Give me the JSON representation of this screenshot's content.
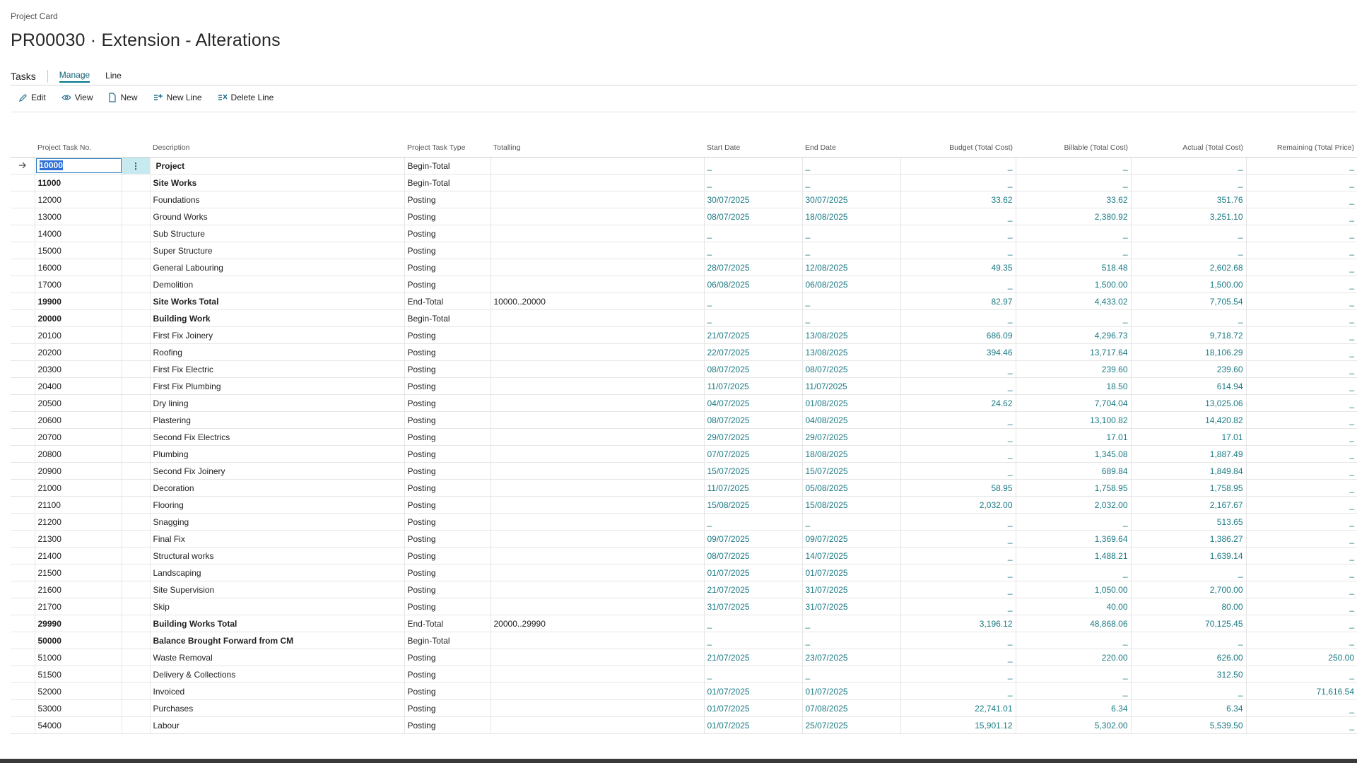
{
  "breadcrumb": "Project Card",
  "title": "PR00030 · Extension - Alterations",
  "menu": {
    "section": "Tasks",
    "tabs": [
      "Manage",
      "Line"
    ]
  },
  "actions": {
    "edit": "Edit",
    "view": "View",
    "new": "New",
    "new_line": "New Line",
    "delete_line": "Delete Line"
  },
  "columns": [
    "Project Task No.",
    "Description",
    "Project Task Type",
    "Totalling",
    "Start Date",
    "End Date",
    "Budget (Total Cost)",
    "Billable (Total Cost)",
    "Actual (Total Cost)",
    "Remaining (Total Price)"
  ],
  "rows": [
    {
      "no": "10000",
      "desc": "Project",
      "type": "Begin-Total",
      "tot": "",
      "start": "_",
      "end": "_",
      "budget": "_",
      "billable": "_",
      "actual": "_",
      "remaining": "_",
      "bold": true,
      "selected": true
    },
    {
      "no": "11000",
      "desc": "Site Works",
      "type": "Begin-Total",
      "tot": "",
      "start": "_",
      "end": "_",
      "budget": "_",
      "billable": "_",
      "actual": "_",
      "remaining": "_",
      "bold": true
    },
    {
      "no": "12000",
      "desc": "Foundations",
      "type": "Posting",
      "tot": "",
      "start": "30/07/2025",
      "end": "30/07/2025",
      "budget": "33.62",
      "billable": "33.62",
      "actual": "351.76",
      "remaining": "_"
    },
    {
      "no": "13000",
      "desc": "Ground Works",
      "type": "Posting",
      "tot": "",
      "start": "08/07/2025",
      "end": "18/08/2025",
      "budget": "_",
      "billable": "2,380.92",
      "actual": "3,251.10",
      "remaining": "_"
    },
    {
      "no": "14000",
      "desc": "Sub Structure",
      "type": "Posting",
      "tot": "",
      "start": "_",
      "end": "_",
      "budget": "_",
      "billable": "_",
      "actual": "_",
      "remaining": "_"
    },
    {
      "no": "15000",
      "desc": "Super Structure",
      "type": "Posting",
      "tot": "",
      "start": "_",
      "end": "_",
      "budget": "_",
      "billable": "_",
      "actual": "_",
      "remaining": "_"
    },
    {
      "no": "16000",
      "desc": "General Labouring",
      "type": "Posting",
      "tot": "",
      "start": "28/07/2025",
      "end": "12/08/2025",
      "budget": "49.35",
      "billable": "518.48",
      "actual": "2,602.68",
      "remaining": "_"
    },
    {
      "no": "17000",
      "desc": "Demolition",
      "type": "Posting",
      "tot": "",
      "start": "06/08/2025",
      "end": "06/08/2025",
      "budget": "_",
      "billable": "1,500.00",
      "actual": "1,500.00",
      "remaining": "_"
    },
    {
      "no": "19900",
      "desc": "Site Works Total",
      "type": "End-Total",
      "tot": "10000..20000",
      "start": "_",
      "end": "_",
      "budget": "82.97",
      "billable": "4,433.02",
      "actual": "7,705.54",
      "remaining": "_",
      "bold": true
    },
    {
      "no": "20000",
      "desc": "Building Work",
      "type": "Begin-Total",
      "tot": "",
      "start": "_",
      "end": "_",
      "budget": "_",
      "billable": "_",
      "actual": "_",
      "remaining": "_",
      "bold": true
    },
    {
      "no": "20100",
      "desc": "First Fix Joinery",
      "type": "Posting",
      "tot": "",
      "start": "21/07/2025",
      "end": "13/08/2025",
      "budget": "686.09",
      "billable": "4,296.73",
      "actual": "9,718.72",
      "remaining": "_"
    },
    {
      "no": "20200",
      "desc": "Roofing",
      "type": "Posting",
      "tot": "",
      "start": "22/07/2025",
      "end": "13/08/2025",
      "budget": "394.46",
      "billable": "13,717.64",
      "actual": "18,106.29",
      "remaining": "_"
    },
    {
      "no": "20300",
      "desc": "First Fix Electric",
      "type": "Posting",
      "tot": "",
      "start": "08/07/2025",
      "end": "08/07/2025",
      "budget": "_",
      "billable": "239.60",
      "actual": "239.60",
      "remaining": "_"
    },
    {
      "no": "20400",
      "desc": "First Fix Plumbing",
      "type": "Posting",
      "tot": "",
      "start": "11/07/2025",
      "end": "11/07/2025",
      "budget": "_",
      "billable": "18.50",
      "actual": "614.94",
      "remaining": "_"
    },
    {
      "no": "20500",
      "desc": "Dry lining",
      "type": "Posting",
      "tot": "",
      "start": "04/07/2025",
      "end": "01/08/2025",
      "budget": "24.62",
      "billable": "7,704.04",
      "actual": "13,025.06",
      "remaining": "_"
    },
    {
      "no": "20600",
      "desc": "Plastering",
      "type": "Posting",
      "tot": "",
      "start": "08/07/2025",
      "end": "04/08/2025",
      "budget": "_",
      "billable": "13,100.82",
      "actual": "14,420.82",
      "remaining": "_"
    },
    {
      "no": "20700",
      "desc": "Second Fix Electrics",
      "type": "Posting",
      "tot": "",
      "start": "29/07/2025",
      "end": "29/07/2025",
      "budget": "_",
      "billable": "17.01",
      "actual": "17.01",
      "remaining": "_"
    },
    {
      "no": "20800",
      "desc": "Plumbing",
      "type": "Posting",
      "tot": "",
      "start": "07/07/2025",
      "end": "18/08/2025",
      "budget": "_",
      "billable": "1,345.08",
      "actual": "1,887.49",
      "remaining": "_"
    },
    {
      "no": "20900",
      "desc": "Second Fix Joinery",
      "type": "Posting",
      "tot": "",
      "start": "15/07/2025",
      "end": "15/07/2025",
      "budget": "_",
      "billable": "689.84",
      "actual": "1,849.84",
      "remaining": "_"
    },
    {
      "no": "21000",
      "desc": "Decoration",
      "type": "Posting",
      "tot": "",
      "start": "11/07/2025",
      "end": "05/08/2025",
      "budget": "58.95",
      "billable": "1,758.95",
      "actual": "1,758.95",
      "remaining": "_"
    },
    {
      "no": "21100",
      "desc": "Flooring",
      "type": "Posting",
      "tot": "",
      "start": "15/08/2025",
      "end": "15/08/2025",
      "budget": "2,032.00",
      "billable": "2,032.00",
      "actual": "2,167.67",
      "remaining": "_"
    },
    {
      "no": "21200",
      "desc": "Snagging",
      "type": "Posting",
      "tot": "",
      "start": "_",
      "end": "_",
      "budget": "_",
      "billable": "_",
      "actual": "513.65",
      "remaining": "_"
    },
    {
      "no": "21300",
      "desc": "Final Fix",
      "type": "Posting",
      "tot": "",
      "start": "09/07/2025",
      "end": "09/07/2025",
      "budget": "_",
      "billable": "1,369.64",
      "actual": "1,386.27",
      "remaining": "_"
    },
    {
      "no": "21400",
      "desc": "Structural works",
      "type": "Posting",
      "tot": "",
      "start": "08/07/2025",
      "end": "14/07/2025",
      "budget": "_",
      "billable": "1,488.21",
      "actual": "1,639.14",
      "remaining": "_"
    },
    {
      "no": "21500",
      "desc": "Landscaping",
      "type": "Posting",
      "tot": "",
      "start": "01/07/2025",
      "end": "01/07/2025",
      "budget": "_",
      "billable": "_",
      "actual": "_",
      "remaining": "_"
    },
    {
      "no": "21600",
      "desc": "Site Supervision",
      "type": "Posting",
      "tot": "",
      "start": "21/07/2025",
      "end": "31/07/2025",
      "budget": "_",
      "billable": "1,050.00",
      "actual": "2,700.00",
      "remaining": "_"
    },
    {
      "no": "21700",
      "desc": "Skip",
      "type": "Posting",
      "tot": "",
      "start": "31/07/2025",
      "end": "31/07/2025",
      "budget": "_",
      "billable": "40.00",
      "actual": "80.00",
      "remaining": "_"
    },
    {
      "no": "29990",
      "desc": "Building Works Total",
      "type": "End-Total",
      "tot": "20000..29990",
      "start": "_",
      "end": "_",
      "budget": "3,196.12",
      "billable": "48,868.06",
      "actual": "70,125.45",
      "remaining": "_",
      "bold": true
    },
    {
      "no": "50000",
      "desc": "Balance Brought Forward from CM",
      "type": "Begin-Total",
      "tot": "",
      "start": "_",
      "end": "_",
      "budget": "_",
      "billable": "_",
      "actual": "_",
      "remaining": "_",
      "bold": true
    },
    {
      "no": "51000",
      "desc": "Waste Removal",
      "type": "Posting",
      "tot": "",
      "start": "21/07/2025",
      "end": "23/07/2025",
      "budget": "_",
      "billable": "220.00",
      "actual": "626.00",
      "remaining": "250.00"
    },
    {
      "no": "51500",
      "desc": "Delivery & Collections",
      "type": "Posting",
      "tot": "",
      "start": "_",
      "end": "_",
      "budget": "_",
      "billable": "_",
      "actual": "312.50",
      "remaining": "_"
    },
    {
      "no": "52000",
      "desc": "Invoiced",
      "type": "Posting",
      "tot": "",
      "start": "01/07/2025",
      "end": "01/07/2025",
      "budget": "_",
      "billable": "_",
      "actual": "_",
      "remaining": "71,616.54"
    },
    {
      "no": "53000",
      "desc": "Purchases",
      "type": "Posting",
      "tot": "",
      "start": "01/07/2025",
      "end": "07/08/2025",
      "budget": "22,741.01",
      "billable": "6.34",
      "actual": "6.34",
      "remaining": "_"
    },
    {
      "no": "54000",
      "desc": "Labour",
      "type": "Posting",
      "tot": "",
      "start": "01/07/2025",
      "end": "25/07/2025",
      "budget": "15,901.12",
      "billable": "5,302.00",
      "actual": "5,539.50",
      "remaining": "_"
    }
  ]
}
